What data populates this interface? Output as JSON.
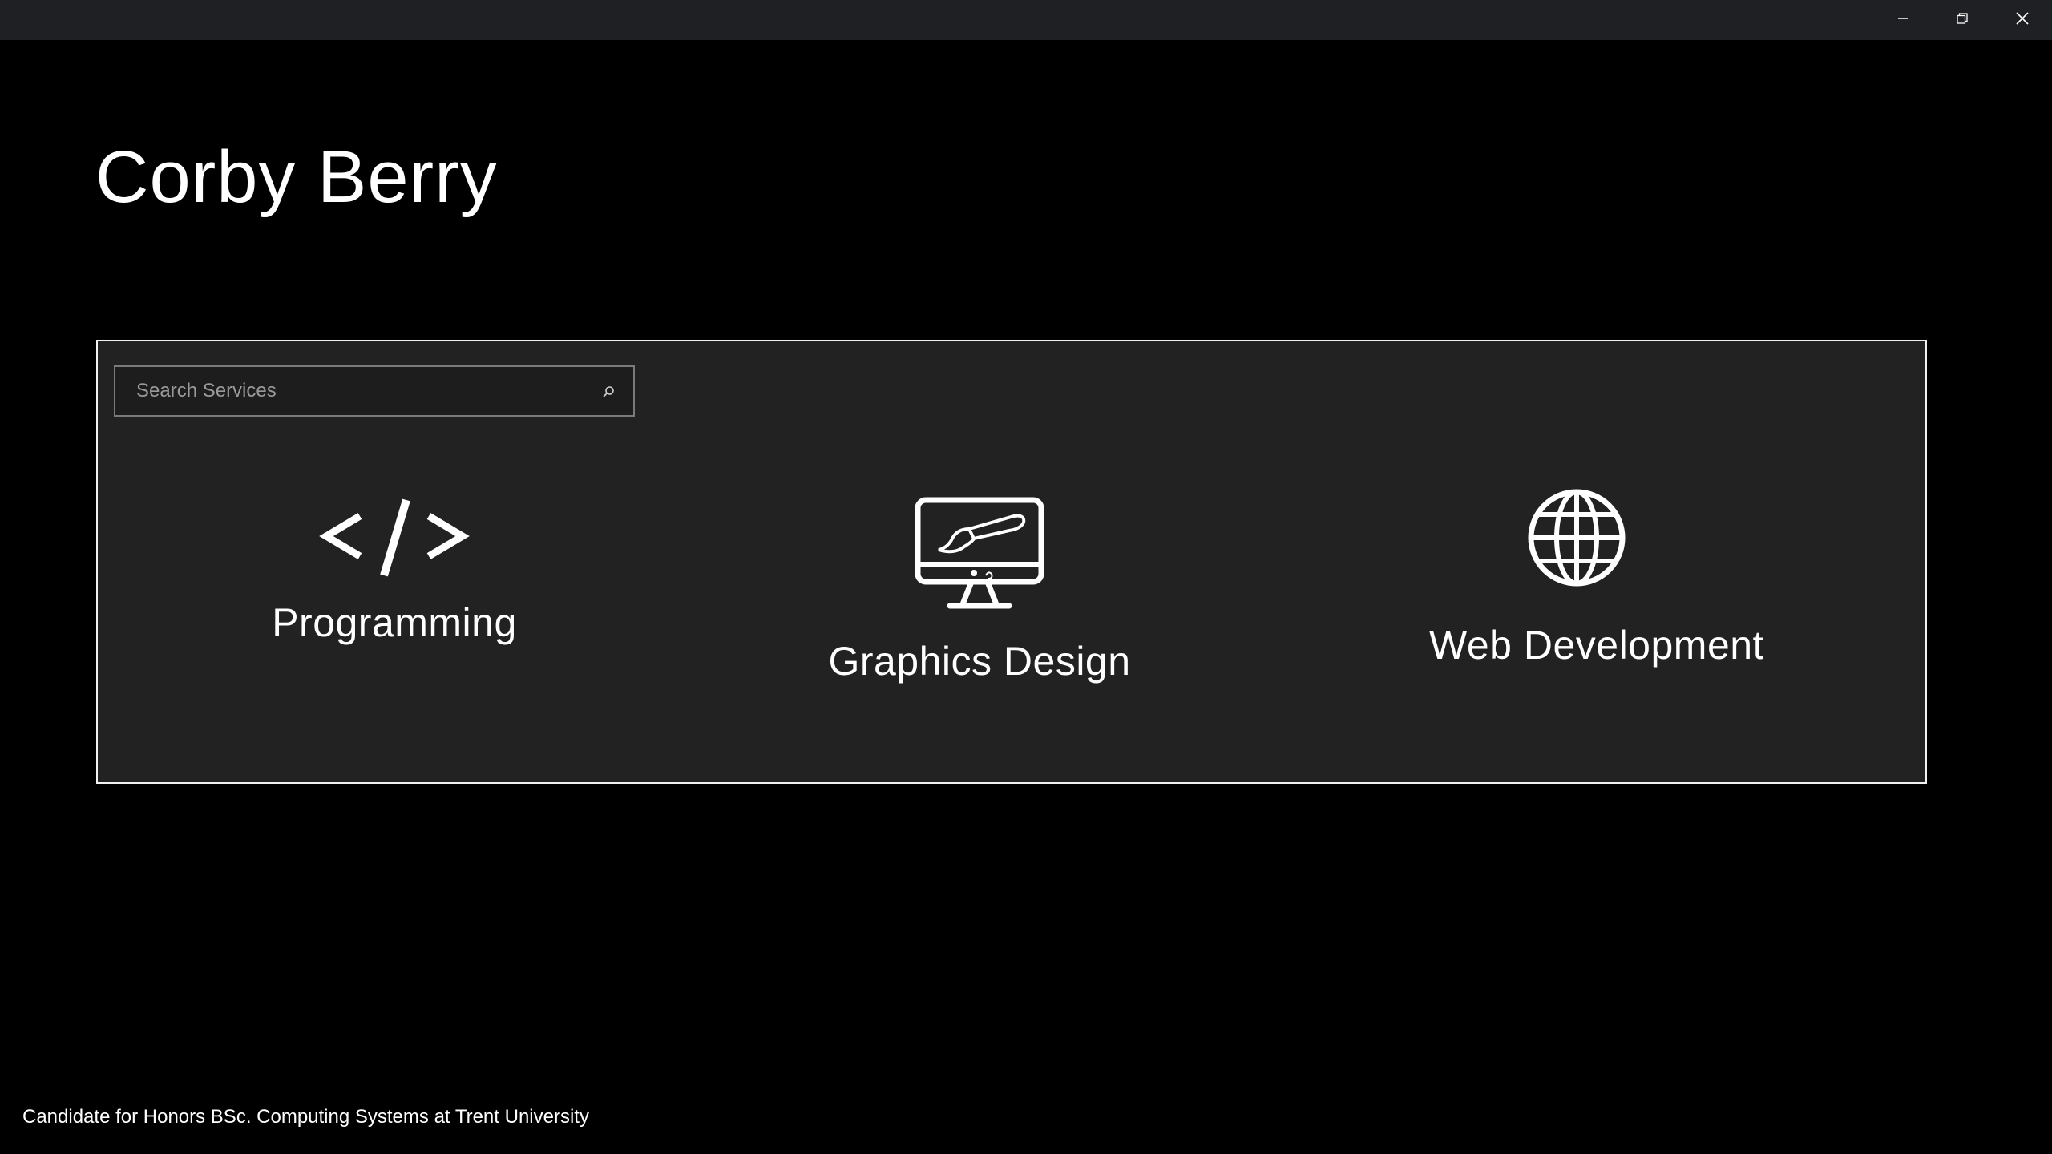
{
  "window": {
    "controls": {
      "minimize_icon": "minimize-icon",
      "restore_icon": "restore-icon",
      "close_icon": "close-icon"
    }
  },
  "header": {
    "title": "Corby Berry"
  },
  "services": {
    "search": {
      "placeholder": "Search Services",
      "value": "",
      "icon": "search-icon"
    },
    "items": [
      {
        "label": "Programming",
        "icon": "code-icon"
      },
      {
        "label": "Graphics Design",
        "icon": "monitor-brush-icon"
      },
      {
        "label": "Web Development",
        "icon": "globe-icon"
      }
    ]
  },
  "footer": {
    "text": "Candidate for Honors BSc. Computing Systems at Trent University"
  },
  "colors": {
    "background": "#000000",
    "titlebar": "#1f2023",
    "panel": "#222222",
    "panel_border": "#f2f2f2",
    "text": "#ffffff"
  }
}
